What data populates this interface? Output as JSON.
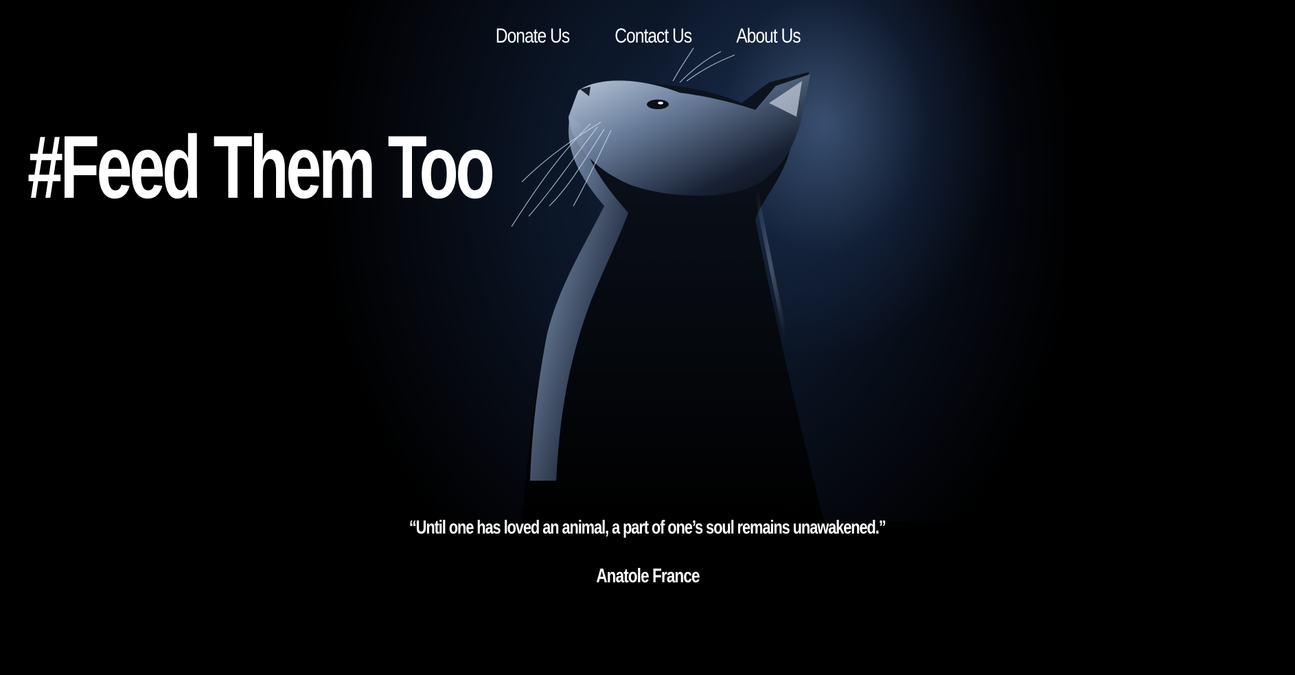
{
  "nav": {
    "items": [
      {
        "label": "Donate Us"
      },
      {
        "label": "Contact Us"
      },
      {
        "label": "About Us"
      }
    ]
  },
  "hero": {
    "headline": "#Feed Them Too",
    "image_alt_icon": "cat-photo"
  },
  "quote": {
    "text": "“Until one has loved an animal, a part of one’s soul remains unawakened.”",
    "author": "Anatole France"
  },
  "colors": {
    "background": "#000000",
    "text": "#ffffff",
    "glow": "#5f7daa"
  }
}
